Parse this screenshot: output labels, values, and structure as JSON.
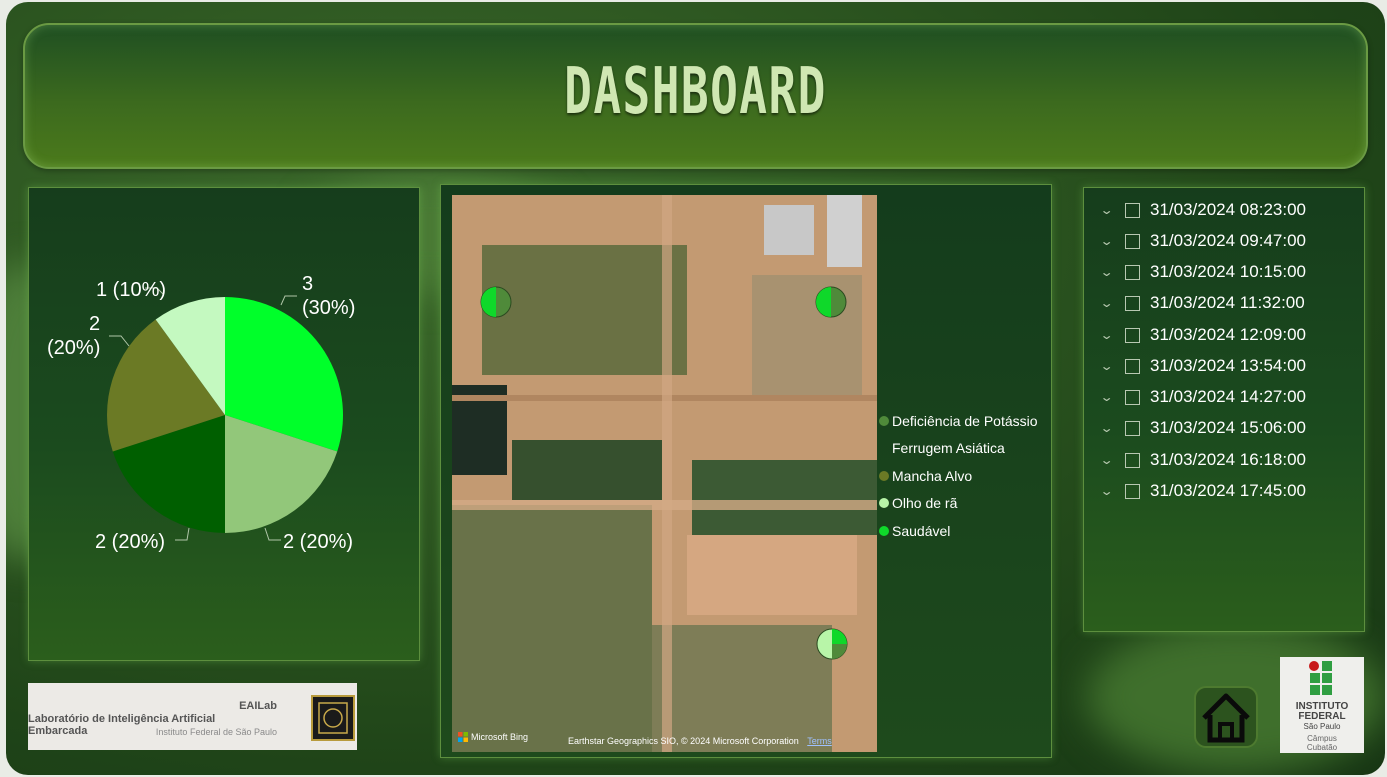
{
  "header": {
    "title": "DASHBOARD"
  },
  "pie": {
    "labels": [
      {
        "name": "Saudável",
        "text_line1": "3",
        "text_line2": "(30%)"
      },
      {
        "name": "Olho de rã",
        "text": "2 (20%)"
      },
      {
        "name": "Mancha Alvo",
        "text": "2 (20%)"
      },
      {
        "name": "Deficiência de Potássio",
        "text_line1": "2",
        "text_line2": "(20%)"
      },
      {
        "name": "Ferrugem Asiática",
        "text": "1 (10%)"
      }
    ]
  },
  "chart_data": {
    "type": "pie",
    "values": [
      3,
      2,
      2,
      2,
      1
    ],
    "labels": [
      "3 (30%)",
      "2 (20%)",
      "2 (20%)",
      "2 (20%)",
      "1 (10%)"
    ],
    "colors": [
      "#00ff2a",
      "#92c77a",
      "#005f00",
      "#6b7a25",
      "#c4f9c0"
    ]
  },
  "map": {
    "attribution_bing": "Microsoft Bing",
    "attribution_text": "Earthstar Geographics SIO, © 2024 Microsoft Corporation",
    "terms": "Terms"
  },
  "legend": {
    "items": [
      {
        "label": "Deficiência de Potássio",
        "color": "#4f8a3a"
      },
      {
        "label": "Ferrugem Asiática",
        "color": ""
      },
      {
        "label": "Mancha Alvo",
        "color": "#6b7a25"
      },
      {
        "label": "Olho de rã",
        "color": "#b8f5a8"
      },
      {
        "label": "Saudável",
        "color": "#0fd82a"
      }
    ]
  },
  "timestamps": [
    "31/03/2024 08:23:00",
    "31/03/2024 09:47:00",
    "31/03/2024 10:15:00",
    "31/03/2024 11:32:00",
    "31/03/2024 12:09:00",
    "31/03/2024 13:54:00",
    "31/03/2024 14:27:00",
    "31/03/2024 15:06:00",
    "31/03/2024 16:18:00",
    "31/03/2024 17:45:00"
  ],
  "logos": {
    "eailab_title": "EAILab",
    "eailab_subtitle": "Laboratório de Inteligência Artificial Embarcada",
    "eailab_institution": "Instituto Federal de São Paulo",
    "if_line1": "INSTITUTO",
    "if_line2": "FEDERAL",
    "if_line3": "São Paulo",
    "if_line4": "Câmpus",
    "if_line5": "Cubatão"
  },
  "icons": {
    "home": "home-icon",
    "chevron": "chevron-down-icon",
    "checkbox": "checkbox"
  }
}
